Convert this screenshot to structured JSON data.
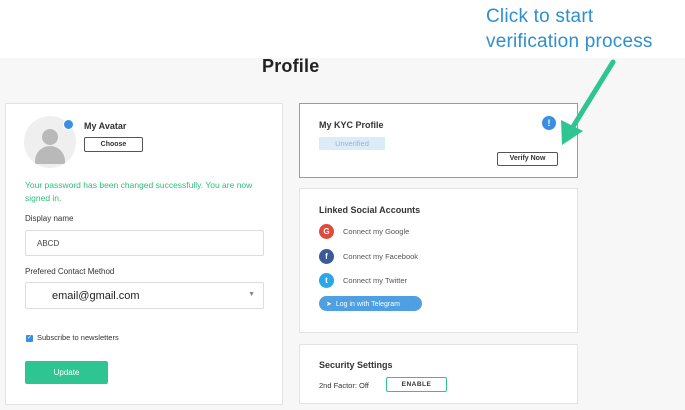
{
  "annotation": {
    "callout_line1": "Click to start",
    "callout_line2": "verification process",
    "arrow_color": "#2ec592"
  },
  "page": {
    "title": "Profile"
  },
  "avatar_card": {
    "avatar_label": "My Avatar",
    "choose_label": "Choose",
    "success_message": "Your password has been changed successfully. You are now signed in.",
    "display_name_label": "Display name",
    "display_name_value": "ABCD",
    "contact_label": "Prefered Contact Method",
    "contact_value": "email@gmail.com",
    "newsletter_label": "Subscribe to newsletters",
    "newsletter_checked": true,
    "update_label": "Update"
  },
  "kyc_card": {
    "heading": "My KYC Profile",
    "status": "Unverified",
    "info_symbol": "!",
    "verify_label": "Verify Now"
  },
  "social_card": {
    "heading": "Linked Social Accounts",
    "items": [
      {
        "icon": "google-icon",
        "glyph": "G",
        "color": "#e04a3c",
        "label": "Connect my Google"
      },
      {
        "icon": "facebook-icon",
        "glyph": "f",
        "color": "#3b5b98",
        "label": "Connect my Facebook"
      },
      {
        "icon": "twitter-icon",
        "glyph": "t",
        "color": "#2ba6e6",
        "label": "Connect my Twitter"
      }
    ],
    "telegram_label": "Log in with Telegram"
  },
  "security_card": {
    "heading": "Security Settings",
    "factor_label": "2nd Factor: Off",
    "enable_label": "ENABLE"
  },
  "colors": {
    "accent_green": "#2ec592",
    "accent_blue": "#3b8fe0",
    "callout_blue": "#2e8fd0"
  }
}
